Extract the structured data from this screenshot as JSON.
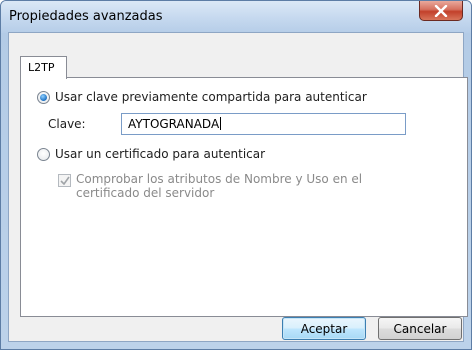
{
  "window": {
    "title": "Propiedades avanzadas"
  },
  "tabs": [
    {
      "label": "L2TP",
      "selected": true
    }
  ],
  "options": {
    "psk_radio_label": "Usar clave previamente compartida para autenticar",
    "psk_selected": true,
    "key_label": "Clave:",
    "key_value": "AYTOGRANADA",
    "cert_radio_label": "Usar un certificado para autenticar",
    "cert_selected": false,
    "verify_checkbox_label": "Comprobar los atributos de Nombre y Uso en el certificado del servidor",
    "verify_checked": true,
    "verify_enabled": false
  },
  "buttons": {
    "accept_label": "Aceptar",
    "cancel_label": "Cancelar"
  },
  "colors": {
    "close_button": "#c2402a",
    "radio_selected": "#1b6fc2"
  },
  "icons": {
    "close": "close-icon",
    "check": "check-icon"
  }
}
